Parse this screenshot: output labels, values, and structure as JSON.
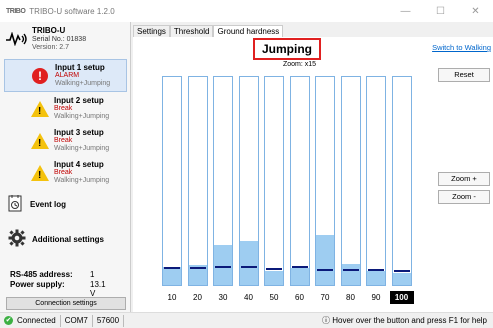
{
  "window": {
    "logo_text": "TRIBO",
    "title": "TRIBO-U software 1.2.0",
    "minimize": "—",
    "maximize": "☐",
    "close": "✕"
  },
  "device": {
    "name": "TRIBO-U",
    "serial": "Serial No.: 01838",
    "version": "Version: 2.7"
  },
  "inputs": [
    {
      "title": "Input 1 setup",
      "status": "ALARM",
      "mode": "Walking+Jumping",
      "icon": "alarm-icon"
    },
    {
      "title": "Input 2 setup",
      "status": "Break",
      "mode": "Walking+Jumping",
      "icon": "warning-icon"
    },
    {
      "title": "Input 3 setup",
      "status": "Break",
      "mode": "Walking+Jumping",
      "icon": "warning-icon"
    },
    {
      "title": "Input 4 setup",
      "status": "Break",
      "mode": "Walking+Jumping",
      "icon": "warning-icon"
    }
  ],
  "sidebar_links": {
    "event_log": "Event log",
    "additional_settings": "Additional settings"
  },
  "rs485": {
    "address_label": "RS-485 address:",
    "address_value": "1",
    "power_label": "Power supply:",
    "power_value": "13.1 V"
  },
  "connection_settings": "Connection settings",
  "statusbar": {
    "icon": "✔",
    "connected": "Connected",
    "port": "COM7",
    "baud": "57600",
    "hint_icon": "ⓘ",
    "hint": "Hover over the button and press F1 for help"
  },
  "tabs": [
    "Settings",
    "Threshold",
    "Ground hardness"
  ],
  "active_tab": "Ground hardness",
  "panel": {
    "mode_title": "Jumping",
    "switch_link": "Switch to Walking",
    "zoom_label": "Zoom: x15",
    "reset": "Reset",
    "zoom_in": "Zoom +",
    "zoom_out": "Zoom -"
  },
  "chart_data": {
    "type": "bar",
    "categories": [
      "10",
      "20",
      "30",
      "40",
      "50",
      "60",
      "70",
      "80",
      "90",
      "100"
    ],
    "values": [
      0.085,
      0.095,
      0.19,
      0.21,
      0.065,
      0.08,
      0.24,
      0.1,
      0.065,
      0.055
    ],
    "markers": [
      0.075,
      0.075,
      0.08,
      0.08,
      0.07,
      0.08,
      0.065,
      0.065,
      0.065,
      0.06
    ],
    "ylim": [
      0,
      1
    ],
    "selected_category": "100",
    "colors": {
      "fill": "#9ecdf1",
      "border": "#7fb3e3",
      "marker": "#0b1a7a"
    }
  }
}
